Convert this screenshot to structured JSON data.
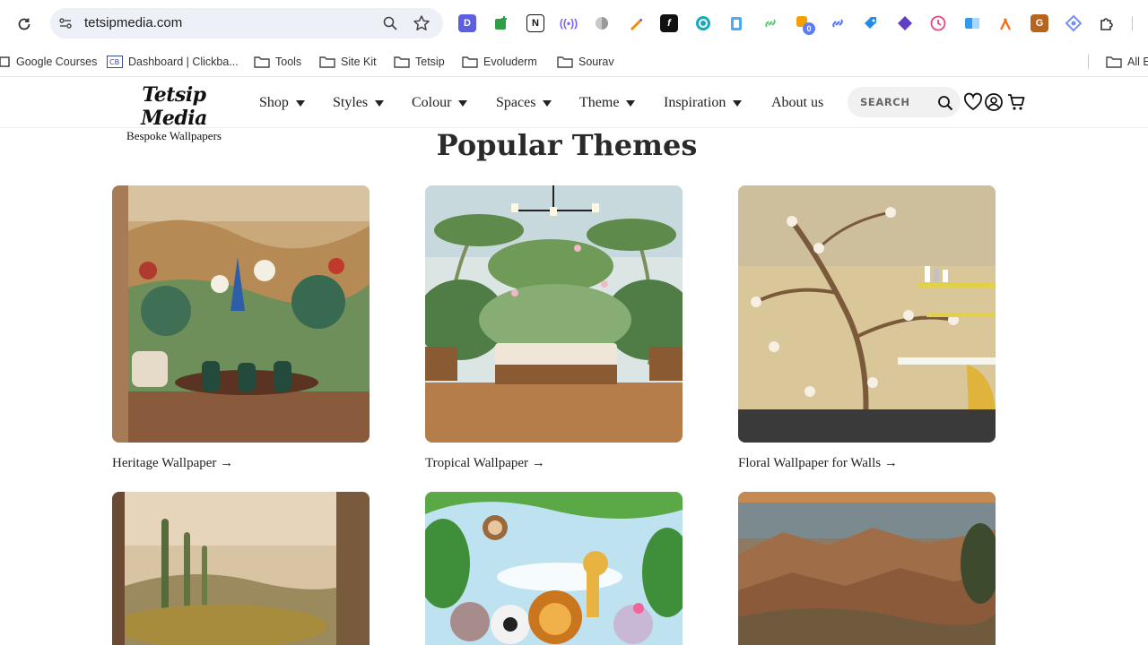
{
  "browser": {
    "url": "tetsipmedia.com",
    "extension_badge": "0",
    "bookmarks": [
      {
        "label": "Google Courses"
      },
      {
        "label": "Dashboard | Clickba..."
      },
      {
        "label": "Tools"
      },
      {
        "label": "Site Kit"
      },
      {
        "label": "Tetsip"
      },
      {
        "label": "Evoluderm"
      },
      {
        "label": "Sourav"
      }
    ],
    "all_bookmarks_label": "All E"
  },
  "site": {
    "logo_name": "Tetsip Media",
    "logo_tagline": "Bespoke Wallpapers",
    "nav": [
      {
        "label": "Shop"
      },
      {
        "label": "Styles"
      },
      {
        "label": "Colour"
      },
      {
        "label": "Spaces"
      },
      {
        "label": "Theme"
      },
      {
        "label": "Inspiration"
      },
      {
        "label": "About us"
      }
    ],
    "search_placeholder": "SEARCH"
  },
  "main": {
    "title": "Popular Themes",
    "cards": [
      {
        "caption": "Heritage Wallpaper →"
      },
      {
        "caption": "Tropical Wallpaper →"
      },
      {
        "caption": "Floral Wallpaper for Walls →"
      },
      {
        "caption": ""
      },
      {
        "caption": ""
      },
      {
        "caption": ""
      }
    ]
  },
  "colors": {
    "omnibox": "#edf1f7",
    "accent_text": "#1f1f1f"
  }
}
